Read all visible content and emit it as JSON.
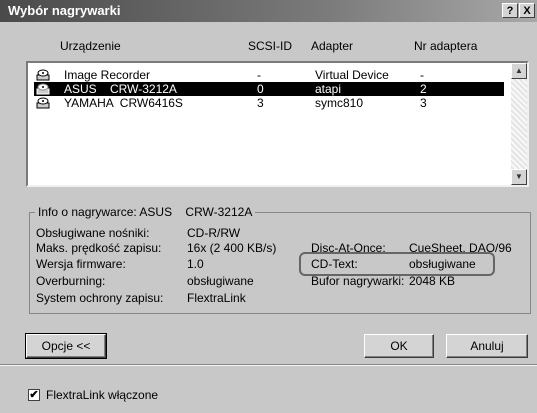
{
  "window": {
    "title": "Wybór nagrywarki",
    "help_label": "?",
    "close_label": "X"
  },
  "columns": {
    "device": "Urządzenie",
    "scsi_id": "SCSI-ID",
    "adapter": "Adapter",
    "adapter_no": "Nr adaptera"
  },
  "devices": [
    {
      "name": "Image Recorder",
      "scsi_id": "-",
      "adapter": "Virtual Device",
      "adapter_no": "-",
      "selected": false
    },
    {
      "name": "ASUS    CRW-3212A",
      "scsi_id": "0",
      "adapter": "atapi",
      "adapter_no": "2",
      "selected": true
    },
    {
      "name": "YAMAHA  CRW6416S",
      "scsi_id": "3",
      "adapter": "symc810",
      "adapter_no": "3",
      "selected": false
    }
  ],
  "info": {
    "legend": "Info o nagrywarce: ASUS    CRW-3212A",
    "media_label": "Obsługiwane nośniki:",
    "media_value": "CD-R/RW",
    "speed_label": "Maks. prędkość zapisu:",
    "speed_value": "16x (2 400 KB/s)",
    "firmware_label": "Wersja firmware:",
    "firmware_value": "1.0",
    "overburn_label": "Overburning:",
    "overburn_value": "obsługiwane",
    "protect_label": "System ochrony zapisu:",
    "protect_value": "FlextraLink",
    "dao_label": "Disc-At-Once:",
    "dao_value": "CueSheet, DAO/96",
    "cdtext_label": "CD-Text:",
    "cdtext_value": "obsługiwane",
    "buffer_label": "Bufor nagrywarki:",
    "buffer_value": "2048 KB"
  },
  "buttons": {
    "options": "Opcje <<",
    "ok": "OK",
    "cancel": "Anuluj"
  },
  "flextralink": {
    "label": "FlextraLink włączone",
    "checked": true,
    "mark": "✔"
  }
}
